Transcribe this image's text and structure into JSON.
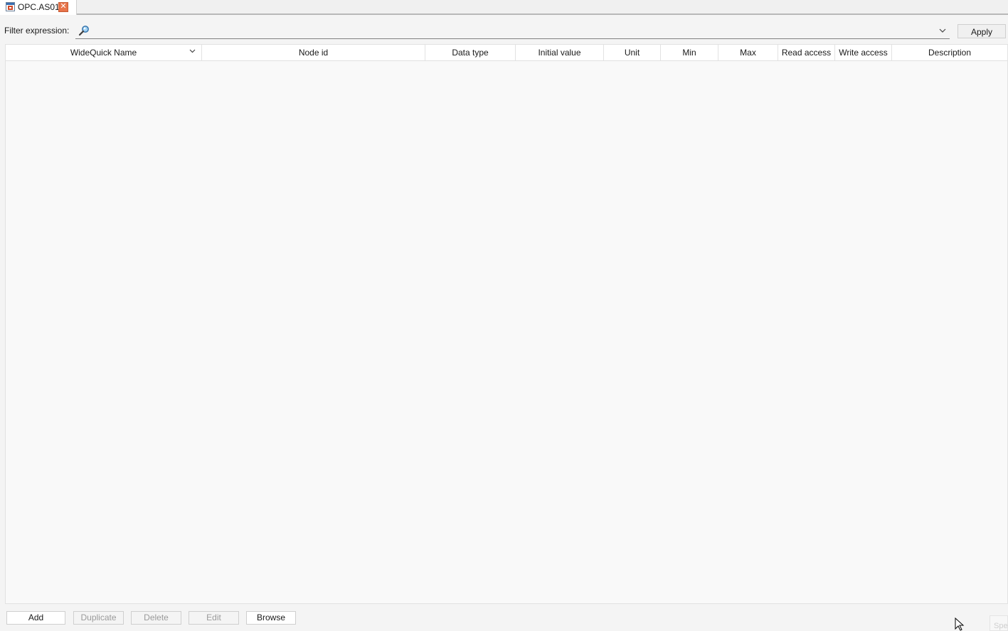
{
  "tab": {
    "title": "OPC.AS01",
    "close_glyph": "✕",
    "icon": "opc-document-icon"
  },
  "filter": {
    "label": "Filter expression:",
    "value": "",
    "placeholder": "",
    "search_icon": "search-icon",
    "dropdown_icon": "chevron-down-icon",
    "apply_label": "Apply"
  },
  "grid": {
    "sort_icon": "chevron-down-icon",
    "columns": [
      "WideQuick Name",
      "Node id",
      "Data type",
      "Initial value",
      "Unit",
      "Min",
      "Max",
      "Read access",
      "Write access",
      "Description"
    ],
    "rows": []
  },
  "actions": {
    "add": "Add",
    "duplicate": "Duplicate",
    "delete": "Delete",
    "edit": "Edit",
    "browse": "Browse"
  },
  "corner_stub_text": "Spe",
  "colors": {
    "close_accent": "#e8744a",
    "grid_background": "#f9f9f9",
    "disabled_text": "#9a9a9a"
  }
}
